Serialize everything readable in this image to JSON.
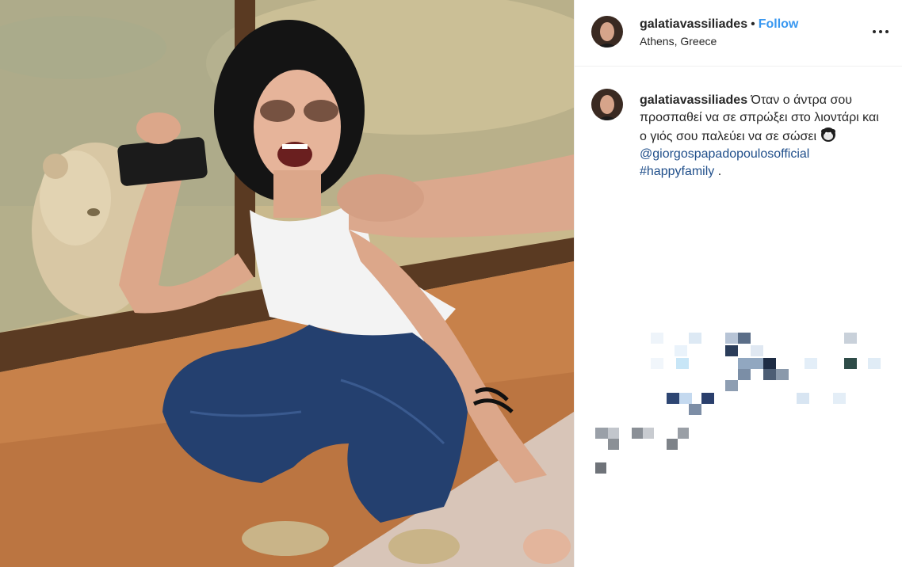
{
  "post": {
    "username": "galatiavassiliades",
    "separator": "•",
    "follow_label": "Follow",
    "location": "Athens, Greece",
    "caption": {
      "text": "Όταν ο άντρα σου προσπαθεί να σε σπρώξει στο λιοντάρι και ο γιός σου παλεύει να σε σώσει",
      "mention": "@giorgospapadopoulosofficial",
      "hashtag": "#happyfamily",
      "trailing": " ."
    },
    "icons": {
      "more": "more-options-icon",
      "emoji": "monkey-face-emoji-icon"
    },
    "colors": {
      "link": "#3897f0",
      "tag": "#1f4e8a",
      "text": "#262626"
    }
  }
}
